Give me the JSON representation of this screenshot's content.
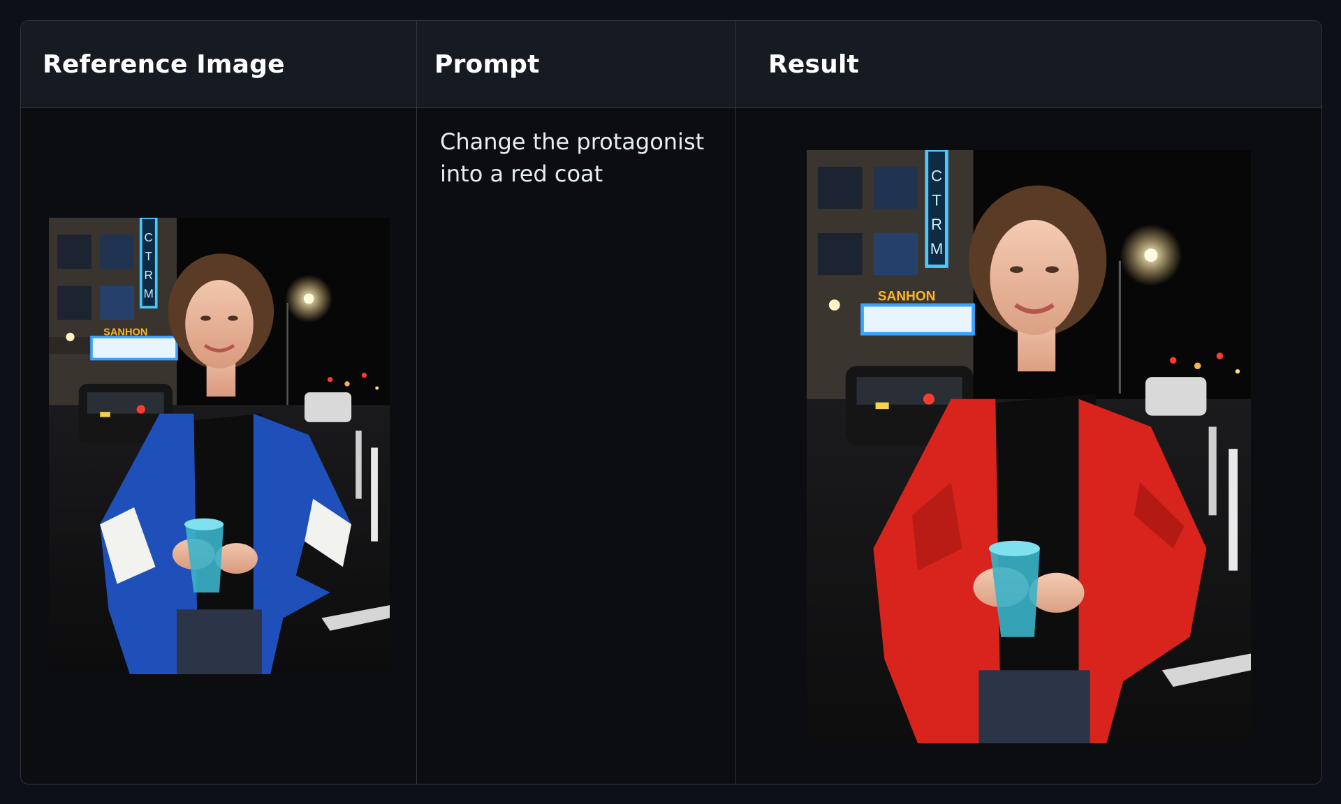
{
  "table": {
    "headers": {
      "reference": "Reference Image",
      "prompt": "Prompt",
      "result": "Result"
    },
    "row": {
      "prompt_text": "Change the protagonist into a red coat",
      "reference_image": {
        "sign_vertical": "CTRM",
        "marquee": "SANHON",
        "coat_color": "#1f4fb8"
      },
      "result_image": {
        "sign_vertical": "CTRM",
        "marquee": "SANHON",
        "coat_color": "#d8241c"
      }
    }
  }
}
